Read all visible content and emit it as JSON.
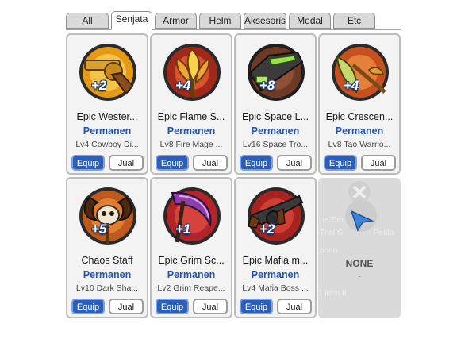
{
  "tabs": [
    "All",
    "Senjata",
    "Armor",
    "Helm",
    "Aksesoris",
    "Medal",
    "Etc"
  ],
  "active_tab": "Senjata",
  "buttons": {
    "equip": "Equip",
    "sell": "Jual"
  },
  "items": [
    {
      "name": "Epic Wester...",
      "duration": "Permanen",
      "desc": "Lv4 Cowboy Di...",
      "badge": "+2",
      "icon": "revolver-icon"
    },
    {
      "name": "Epic Flame S...",
      "duration": "Permanen",
      "desc": "Lv8 Fire Mage ...",
      "badge": "+4",
      "icon": "flame-staff-icon"
    },
    {
      "name": "Epic Space L...",
      "duration": "Permanen",
      "desc": "Lv16 Space Tro...",
      "badge": "+8",
      "icon": "space-gun-icon"
    },
    {
      "name": "Epic Crescen...",
      "duration": "Permanen",
      "desc": "Lv8 Tao Warrio...",
      "badge": "+4",
      "icon": "crescent-blade-icon"
    },
    {
      "name": "Chaos Staff",
      "duration": "Permanen",
      "desc": "Lv10 Dark Sha...",
      "badge": "+5",
      "icon": "horned-skull-icon"
    },
    {
      "name": "Epic Grim Sc...",
      "duration": "Permanen",
      "desc": "Lv2 Grim Reape...",
      "badge": "+1",
      "icon": "scythe-icon"
    },
    {
      "name": "Epic Mafia m...",
      "duration": "Permanen",
      "desc": "Lv4 Mafia Boss ...",
      "badge": "+2",
      "icon": "tommy-gun-icon"
    }
  ],
  "empty_slot": {
    "label": "NONE",
    "dash": "-",
    "ghost_text": [
      "ne Tim",
      "Trial G",
      "Pesto",
      "anen",
      "1 item II"
    ],
    "icons": [
      "close-icon",
      "cursor-arrow-icon"
    ]
  },
  "colors": {
    "accent": "#2b5fb8",
    "duration_text": "#2354b0",
    "card_bg": "#f3f3f3",
    "empty_bg": "#dadada"
  }
}
